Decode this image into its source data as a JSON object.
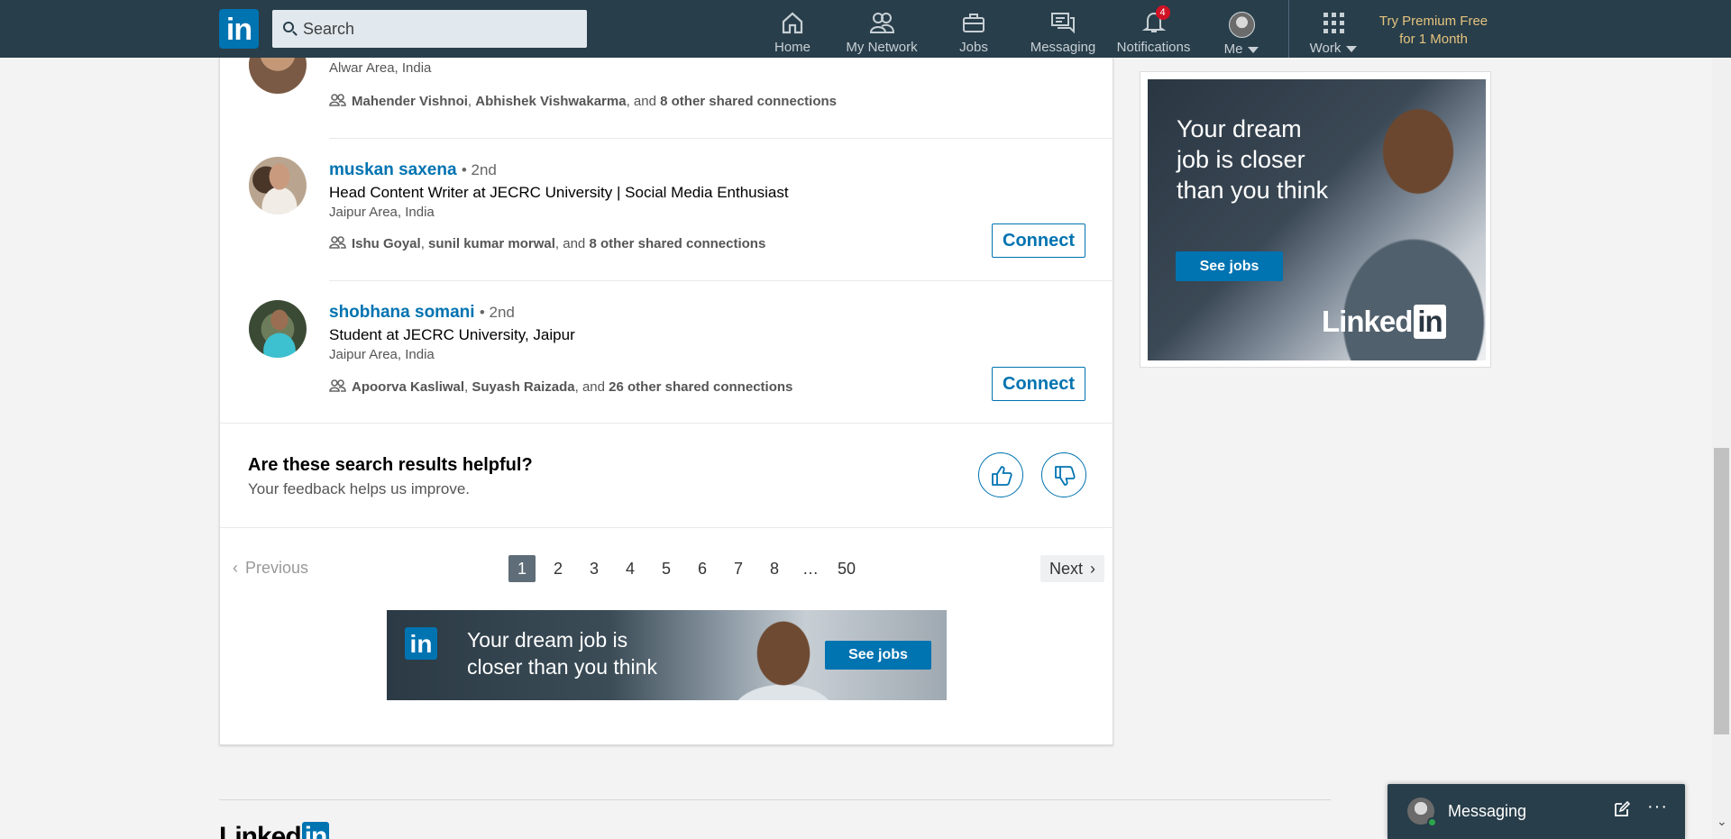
{
  "navbar": {
    "logo_text": "in",
    "search_placeholder": "Search",
    "items": [
      {
        "label": "Home",
        "icon": "home-icon"
      },
      {
        "label": "My Network",
        "icon": "network-icon"
      },
      {
        "label": "Jobs",
        "icon": "briefcase-icon"
      },
      {
        "label": "Messaging",
        "icon": "chat-icon"
      },
      {
        "label": "Notifications",
        "icon": "bell-icon",
        "badge": "4"
      },
      {
        "label": "Me",
        "icon": "avatar"
      },
      {
        "label": "Work",
        "icon": "grid-icon"
      }
    ],
    "premium_line1": "Try Premium Free",
    "premium_line2": "for 1 Month"
  },
  "results": [
    {
      "name": "",
      "degree": "",
      "headline": "",
      "location": "Alwar Area, India",
      "shared_1": "Mahender Vishnoi",
      "shared_2": "Abhishek Vishwakarma",
      "shared_conj": ", and ",
      "shared_count": "8 other shared connections"
    },
    {
      "name": "muskan saxena",
      "degree": "• 2nd",
      "headline": "Head Content Writer at JECRC University | Social Media Enthusiast",
      "location": "Jaipur Area, India",
      "shared_1": "Ishu Goyal",
      "shared_2": "sunil kumar morwal",
      "shared_conj": ", and ",
      "shared_count": "8 other shared connections",
      "button": "Connect"
    },
    {
      "name": "shobhana somani",
      "degree": "• 2nd",
      "headline": "Student at JECRC University, Jaipur",
      "location": "Jaipur Area, India",
      "shared_1": "Apoorva Kasliwal",
      "shared_2": "Suyash Raizada",
      "shared_conj": ", and ",
      "shared_count": "26 other shared connections",
      "button": "Connect"
    }
  ],
  "feedback": {
    "title": "Are these search results helpful?",
    "subtitle": "Your feedback helps us improve."
  },
  "pagination": {
    "prev": "Previous",
    "pages": [
      "1",
      "2",
      "3",
      "4",
      "5",
      "6",
      "7",
      "8",
      "…",
      "50"
    ],
    "active": "1",
    "next": "Next"
  },
  "banner_ad": {
    "logo": "in",
    "line1": "Your dream job is",
    "line2": "closer than you think",
    "button": "See jobs"
  },
  "side_ad": {
    "text": "Your dream job is closer than you think",
    "button": "See jobs",
    "logo_word": "Linked",
    "logo_in": "in"
  },
  "footer": {
    "logo_word": "Linked",
    "logo_in": "in"
  },
  "messaging": {
    "title": "Messaging",
    "more": "···"
  },
  "colors": {
    "navbar_bg": "#283e4a",
    "brand_blue": "#0073b1",
    "premium_gold": "#e5c37e",
    "badge_red": "#d11124"
  }
}
